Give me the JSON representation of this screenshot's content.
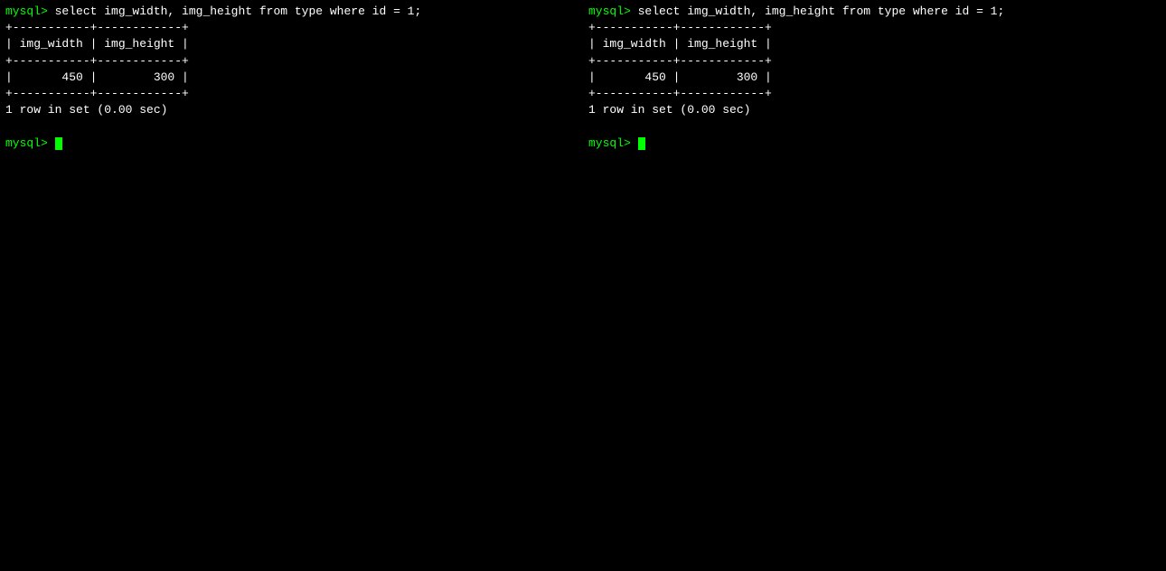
{
  "terminals": [
    {
      "id": "left-terminal",
      "lines": [
        {
          "type": "command",
          "text": "mysql> select img_width, img_height from type where id = 1;"
        },
        {
          "type": "table",
          "text": "+-----------+------------+"
        },
        {
          "type": "table",
          "text": "| img_width | img_height |"
        },
        {
          "type": "table",
          "text": "+-----------+------------+"
        },
        {
          "type": "table",
          "text": "|       450 |        300 |"
        },
        {
          "type": "table",
          "text": "+-----------+------------+"
        },
        {
          "type": "result",
          "text": "1 row in set (0.00 sec)"
        },
        {
          "type": "empty",
          "text": ""
        },
        {
          "type": "prompt",
          "text": "mysql> "
        }
      ]
    },
    {
      "id": "right-terminal",
      "lines": [
        {
          "type": "command",
          "text": "mysql> select img_width, img_height from type where id = 1;"
        },
        {
          "type": "table",
          "text": "+-----------+------------+"
        },
        {
          "type": "table",
          "text": "| img_width | img_height |"
        },
        {
          "type": "table",
          "text": "+-----------+------------+"
        },
        {
          "type": "table",
          "text": "|       450 |        300 |"
        },
        {
          "type": "table",
          "text": "+-----------+------------+"
        },
        {
          "type": "result",
          "text": "1 row in set (0.00 sec)"
        },
        {
          "type": "empty",
          "text": ""
        },
        {
          "type": "prompt",
          "text": "mysql> "
        }
      ]
    }
  ]
}
